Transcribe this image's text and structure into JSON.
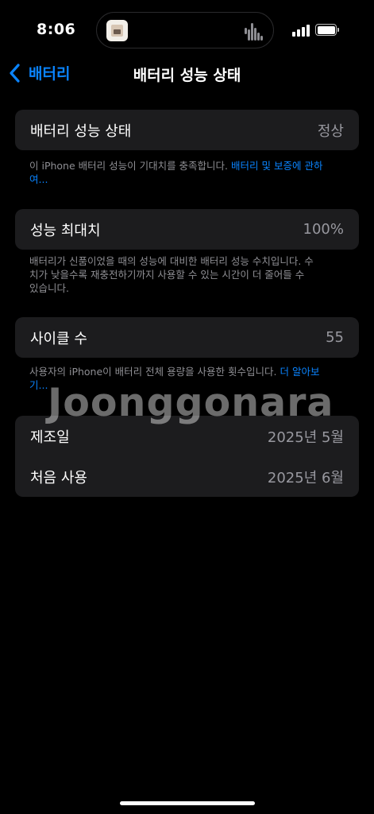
{
  "status_bar": {
    "time": "8:06"
  },
  "nav": {
    "back_label": "배터리",
    "title": "배터리 성능 상태"
  },
  "health": {
    "label": "배터리 성능 상태",
    "value": "정상",
    "note": "이 iPhone 배터리 성능이 기대치를 충족합니다.",
    "link": "배터리 및 보증에 관하여..."
  },
  "max_capacity": {
    "label": "성능 최대치",
    "value": "100%",
    "note": "배터리가 신품이었을 때의 성능에 대비한 배터리 성능 수치입니다. 수치가 낮을수록 재충전하기까지 사용할 수 있는 시간이 더 줄어들 수 있습니다."
  },
  "cycle": {
    "label": "사이클 수",
    "value": "55",
    "note": "사용자의 iPhone이 배터리 전체 용량을 사용한 횟수입니다.",
    "link": "더 알아보기..."
  },
  "dates": {
    "manufacture_label": "제조일",
    "manufacture_value": "2025년 5월",
    "first_use_label": "처음 사용",
    "first_use_value": "2025년 6월"
  },
  "watermark": "Joonggonara",
  "colors": {
    "accent": "#0a84ff",
    "background": "#000000",
    "cell": "#1c1c1e",
    "secondary_text": "#8e8e93"
  }
}
